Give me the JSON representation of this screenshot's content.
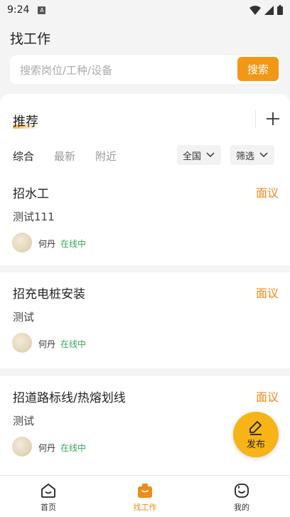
{
  "status_bar": {
    "time": "9:24",
    "notification_letter": "A"
  },
  "header": {
    "title": "找工作"
  },
  "search": {
    "placeholder": "搜索岗位/工种/设备",
    "button_label": "搜索"
  },
  "recommend": {
    "title": "推荐",
    "tabs": [
      {
        "label": "综合",
        "active": true
      },
      {
        "label": "最新",
        "active": false
      },
      {
        "label": "附近",
        "active": false
      }
    ],
    "filters": {
      "region": "全国",
      "filter": "筛选"
    }
  },
  "jobs": [
    {
      "title": "招水工",
      "salary": "面议",
      "description": "测试111",
      "user_name": "何丹",
      "user_status": "在线中"
    },
    {
      "title": "招充电桩安装",
      "salary": "面议",
      "description": "测试",
      "user_name": "何丹",
      "user_status": "在线中"
    },
    {
      "title": "招道路标线/热熔划线",
      "salary": "面议",
      "description": "测试",
      "user_name": "何丹",
      "user_status": "在线中"
    }
  ],
  "fab": {
    "label": "发布",
    "icon": "edit-icon"
  },
  "tabbar": {
    "items": [
      {
        "label": "首页",
        "icon": "home-icon",
        "active": false
      },
      {
        "label": "找工作",
        "icon": "briefcase-icon",
        "active": true
      },
      {
        "label": "我的",
        "icon": "smile-icon",
        "active": false
      }
    ]
  },
  "colors": {
    "accent": "#f39716",
    "salary": "#f08a16",
    "online": "#3aa55c",
    "fab": "#f8b416"
  }
}
